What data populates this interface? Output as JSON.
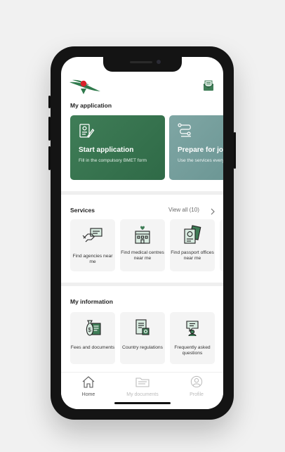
{
  "sections": {
    "my_application": "My application",
    "services": "Services",
    "my_information": "My information"
  },
  "cards": [
    {
      "title": "Start application",
      "desc": "Fill in the compulsory BMET form",
      "color": "#3f7d57"
    },
    {
      "title": "Prepare for jo",
      "desc": "Use the services every step of the",
      "color": "#7fa6a4"
    }
  ],
  "services": {
    "view_all": "View all (10)",
    "items": [
      {
        "label": "Find agencies near me",
        "icon": "handshake-icon"
      },
      {
        "label": "Find medical centres near me",
        "icon": "hospital-icon"
      },
      {
        "label": "Find passport offices near me",
        "icon": "passport-icon"
      }
    ]
  },
  "information": {
    "items": [
      {
        "label": "Fees and documents",
        "icon": "money-bag-icon"
      },
      {
        "label": "Country regulations",
        "icon": "regulations-icon"
      },
      {
        "label": "Frequently asked questions",
        "icon": "faq-icon"
      }
    ]
  },
  "tabs": [
    {
      "label": "Home",
      "icon": "home-icon",
      "active": true
    },
    {
      "label": "My documents",
      "icon": "folder-icon",
      "active": false
    },
    {
      "label": "Profile",
      "icon": "profile-icon",
      "active": false
    }
  ],
  "colors": {
    "brand_green": "#3f7d57",
    "teal": "#7fa6a4",
    "tile_bg": "#f4f4f4"
  }
}
